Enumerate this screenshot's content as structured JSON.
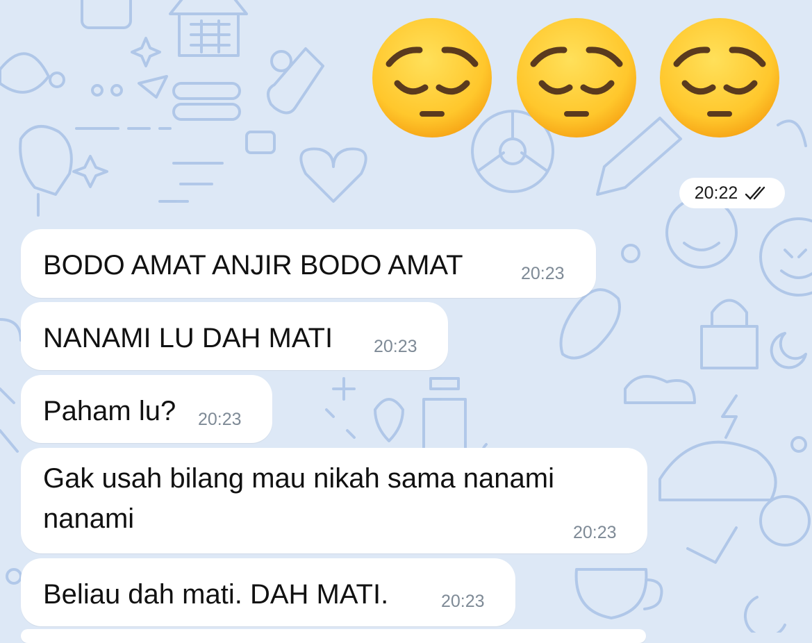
{
  "wallpaper": {
    "background_color": "#dde8f6",
    "doodle_color": "#a7c1e6"
  },
  "outgoing": {
    "emojis": [
      "pensive-face-emoji",
      "pensive-face-emoji",
      "pensive-face-emoji"
    ],
    "time": "20:22",
    "status_icon": "double-check-icon"
  },
  "messages": [
    {
      "text": "BODO AMAT ANJIR BODO AMAT",
      "time": "20:23"
    },
    {
      "text": "NANAMI LU DAH MATI",
      "time": "20:23"
    },
    {
      "text": "Paham lu?",
      "time": "20:23"
    },
    {
      "text_line1": "Gak usah bilang mau nikah sama nanami",
      "text_line2": "nanami",
      "time": "20:23"
    },
    {
      "text": "Beliau dah mati. DAH MATI.",
      "time": "20:23"
    }
  ]
}
